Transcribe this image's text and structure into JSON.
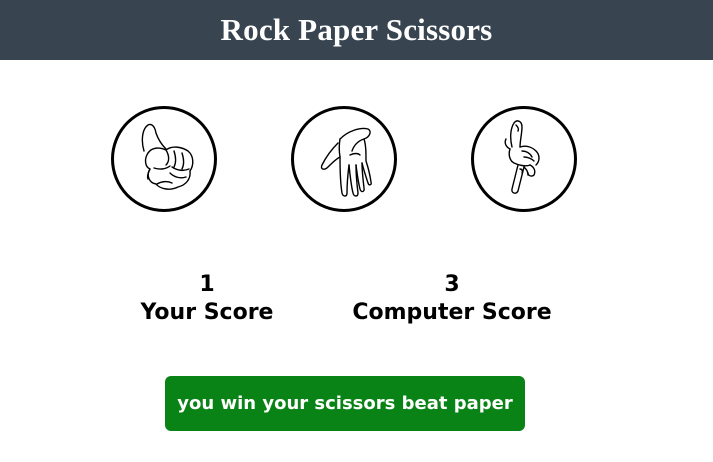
{
  "header": {
    "title": "Rock Paper Scissors"
  },
  "choices": [
    {
      "name": "rock",
      "icon": "rock-hand-icon"
    },
    {
      "name": "paper",
      "icon": "paper-hand-icon"
    },
    {
      "name": "scissors",
      "icon": "scissors-hand-icon"
    }
  ],
  "scoreboard": {
    "user": {
      "value": "1",
      "label": "Your Score"
    },
    "computer": {
      "value": "3",
      "label": "Computer Score"
    }
  },
  "result": {
    "message": "you win your scissors beat paper",
    "color": "#098316"
  },
  "colors": {
    "header_bg": "#384551",
    "header_text": "#ffffff"
  }
}
